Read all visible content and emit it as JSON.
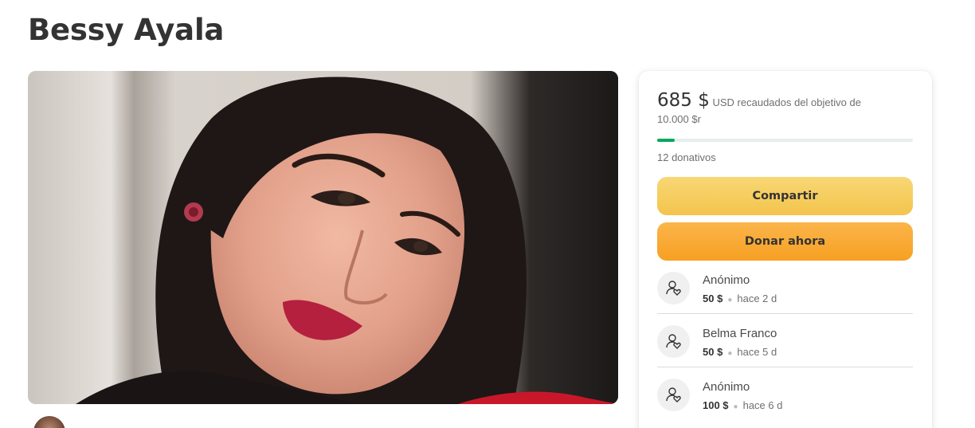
{
  "page": {
    "title": "Bessy Ayala"
  },
  "fundraiser": {
    "raised_amount": "685 $",
    "raised_text": "USD recaudados del objetivo de",
    "goal_text": "10.000 $r",
    "progress_fraction": 0.0685,
    "donations_count": "12 donativos",
    "share_label": "Compartir",
    "donate_label": "Donar ahora"
  },
  "donors": [
    {
      "name": "Anónimo",
      "amount": "50 $",
      "time": "hace 2 d"
    },
    {
      "name": "Belma Franco",
      "amount": "50 $",
      "time": "hace 5 d"
    },
    {
      "name": "Anónimo",
      "amount": "100 $",
      "time": "hace 6 d"
    }
  ],
  "icons": {
    "donor": "donor-heart-icon"
  },
  "colors": {
    "progress": "#02a95c",
    "share": "#f3c44d",
    "donate": "#f7a023"
  }
}
